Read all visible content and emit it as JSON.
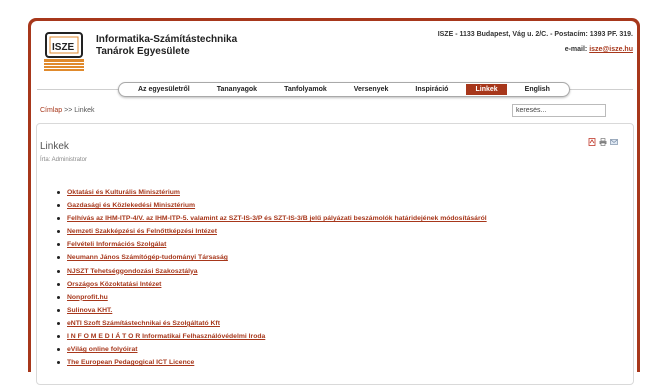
{
  "header": {
    "org_line1": "Informatika-Számítástechnika",
    "org_line2": "Tanárok Egyesülete",
    "logo_text": "ISZE",
    "contact_address": "ISZE - 1133 Budapest, Vág u. 2/C. - Postacím: 1393 PF. 319.",
    "email_label": "e-mail:",
    "email": "isze@isze.hu"
  },
  "nav": {
    "items": [
      {
        "label": "Az egyesületről",
        "active": false
      },
      {
        "label": "Tananyagok",
        "active": false
      },
      {
        "label": "Tanfolyamok",
        "active": false
      },
      {
        "label": "Versenyek",
        "active": false
      },
      {
        "label": "Inspiráció",
        "active": false
      },
      {
        "label": "Linkek",
        "active": true
      },
      {
        "label": "English",
        "active": false
      }
    ]
  },
  "breadcrumb": {
    "home": "Címlap",
    "separator": ">>",
    "current": "Linkek"
  },
  "search": {
    "value": "keresés..."
  },
  "article": {
    "title": "Linkek",
    "author": "Írta: Administrator",
    "action_icons": [
      "pdf-icon",
      "print-icon",
      "email-icon"
    ]
  },
  "links": [
    "Oktatási és Kulturális Minisztérium",
    "Gazdasági és Közlekedési Minisztérium",
    "Felhívás az IHM-ITP-4/V. az IHM-ITP-5. valamint az SZT-IS-3/P és SZT-IS-3/B jelű pályázati beszámolók határidejének módosításáról",
    "Nemzeti Szakképzési és Felnőttképzési Intézet",
    "Felvételi Információs Szolgálat",
    "Neumann János Számítógép-tudományi Társaság",
    "NJSZT Tehetséggondozási Szakosztálya",
    "Országos Közoktatási Intézet",
    "Nonprofit.hu",
    "Sulinova KHT.",
    "eNTI Szoft Számítástechnikai és Szolgáltató Kft",
    "I N F O M E D I Á T O R Informatikai Felhasználóvédelmi Iroda",
    "eVilág online folyóirat",
    "The European Pedagogical ICT Licence"
  ],
  "colors": {
    "brand": "#a7371b",
    "text": "#222222"
  }
}
